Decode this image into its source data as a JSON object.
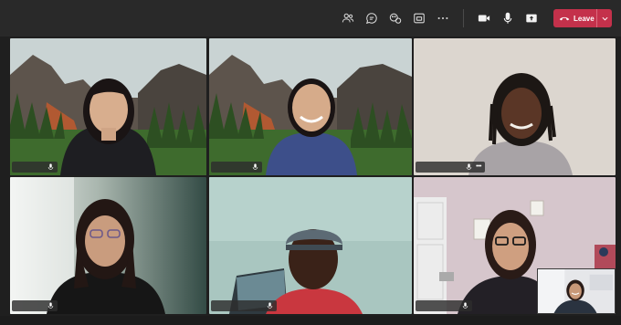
{
  "toolbar": {
    "leave_label": "Leave",
    "leave_color": "#c4314b",
    "icons": [
      "people-icon",
      "chat-icon",
      "reactions-icon",
      "share-tray-icon",
      "more-icon",
      "camera-icon",
      "mic-icon",
      "share-icon"
    ]
  },
  "participants": [
    {
      "background": "mountain-lake-scene"
    },
    {
      "background": "mountain-lake-scene"
    },
    {
      "background": "plain-wall"
    },
    {
      "background": "office-window"
    },
    {
      "background": "room-wall"
    },
    {
      "background": "bedroom-door"
    }
  ],
  "colors": {
    "app_background": "#1f1f1f",
    "toolbar_background": "#292929"
  }
}
